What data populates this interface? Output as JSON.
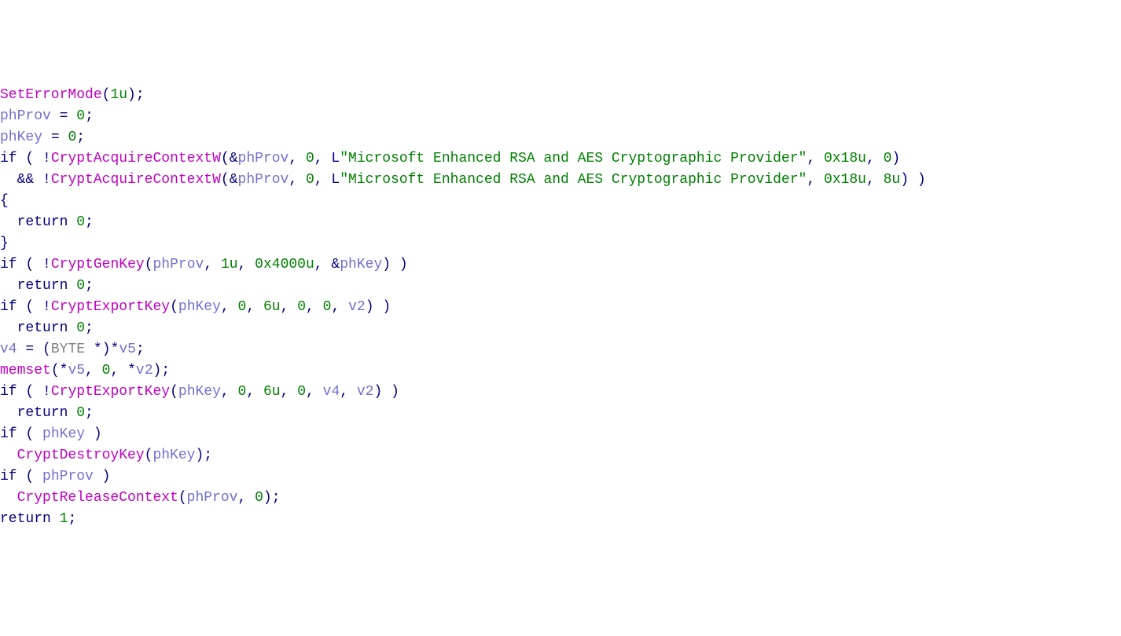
{
  "code": {
    "t": {
      "SetErrorMode": "SetErrorMode",
      "CryptAcquireContextW": "CryptAcquireContextW",
      "CryptGenKey": "CryptGenKey",
      "CryptExportKey": "CryptExportKey",
      "CryptDestroyKey": "CryptDestroyKey",
      "CryptReleaseContext": "CryptReleaseContext",
      "memset": "memset",
      "phProv": "phProv",
      "phKey": "phKey",
      "v2": "v2",
      "v4": "v4",
      "v5": "v5",
      "BYTE": "BYTE",
      "return": "return",
      "if": "if",
      "L": "L",
      "str_provider": "\"Microsoft Enhanced RSA and AES Cryptographic Provider\"",
      "n1u": "1u",
      "n0": "0",
      "n1": "1",
      "n6u": "6u",
      "n8u": "8u",
      "n0x18u": "0x18u",
      "n0x4000u": "0x4000u",
      "amp": "&&",
      "addr": "&",
      "eq": "=",
      "star": "*",
      "bang": "!",
      "lp": "(",
      "rp": ")",
      "lb": "{",
      "rb": "}",
      "comma": ",",
      "semi": ";",
      "sp": " "
    }
  }
}
